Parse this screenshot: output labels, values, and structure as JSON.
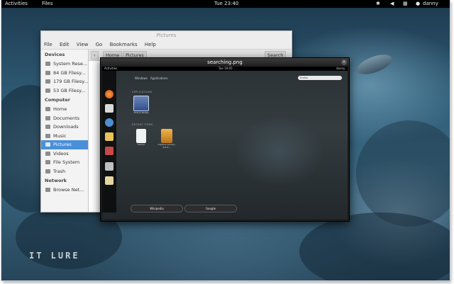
{
  "topbar": {
    "activities": "Activities",
    "app_menu": "Files",
    "clock": "Tue 23:40",
    "user": "danny"
  },
  "files_window": {
    "title": "Pictures",
    "menu": [
      "File",
      "Edit",
      "View",
      "Go",
      "Bookmarks",
      "Help"
    ],
    "breadcrumbs": [
      "Home",
      "Pictures"
    ],
    "search_label": "Search",
    "sidebar": {
      "devices_heading": "Devices",
      "devices": [
        "System Rese...",
        "84 GB Filesy...",
        "179 GB Filesy...",
        "53 GB Filesy..."
      ],
      "computer_heading": "Computer",
      "computer": [
        "Home",
        "Documents",
        "Downloads",
        "Music",
        "Pictures",
        "Videos",
        "File System",
        "Trash"
      ],
      "selected": "Pictures",
      "network_heading": "Network",
      "network": [
        "Browse Net..."
      ]
    }
  },
  "viewer_window": {
    "title": "searching.png",
    "close_glyph": "×",
    "shot": {
      "activities": "Activities",
      "clock": "Tue 19:05",
      "user": "danny",
      "tabs": [
        "Windows",
        "Applications"
      ],
      "search_text": "firefox",
      "cat_applications": "APPLICATIONS",
      "app_name": "Fedora Badge",
      "cat_recent": "RECENT ITEMS",
      "recent": [
        "fedora",
        "mailbox-version-3.0-fc..."
      ],
      "buttons": [
        "Wikipedia",
        "Google"
      ]
    }
  },
  "watermark": "IT LURE"
}
